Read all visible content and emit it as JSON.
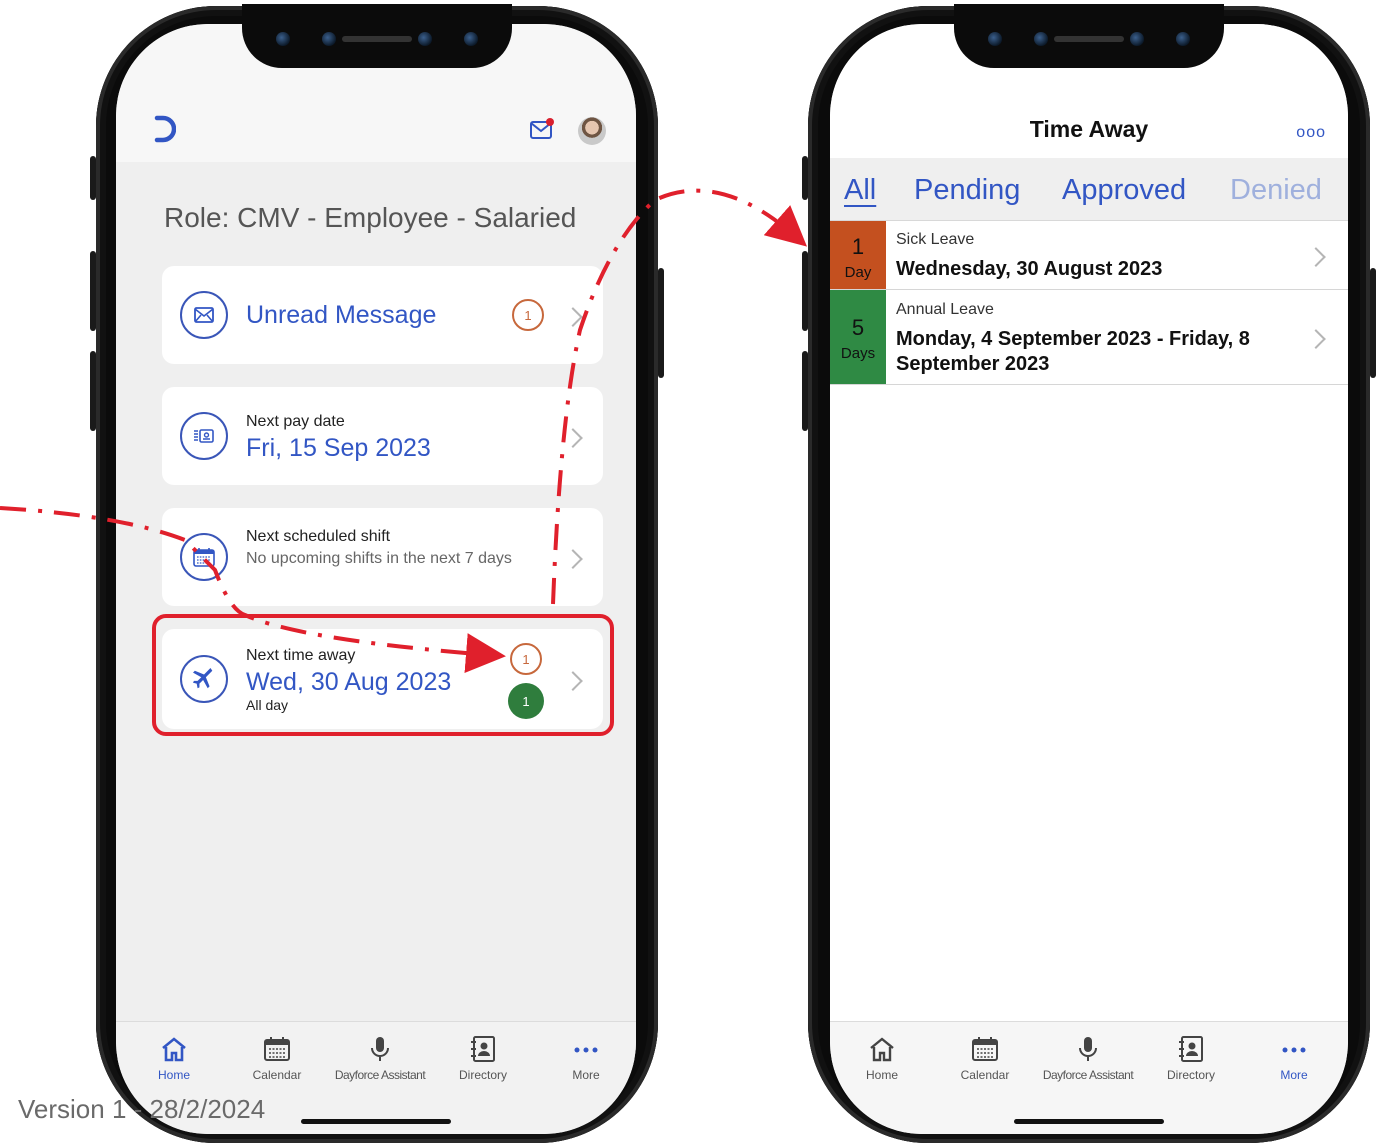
{
  "left_phone": {
    "role": "Role: CMV - Employee - Salaried",
    "cards": {
      "unread": {
        "label": "Unread Message",
        "badge": "1"
      },
      "pay": {
        "label": "Next pay date",
        "value": "Fri, 15 Sep 2023"
      },
      "shift": {
        "label": "Next scheduled shift",
        "value": "No upcoming shifts in the next 7 days"
      },
      "timeaway": {
        "label": "Next time away",
        "value": "Wed, 30 Aug 2023",
        "sub": "All day",
        "badge_pending": "1",
        "badge_approved": "1"
      }
    },
    "nav": [
      {
        "label": "Home"
      },
      {
        "label": "Calendar"
      },
      {
        "label": "Dayforce Assistant"
      },
      {
        "label": "Directory"
      },
      {
        "label": "More"
      }
    ]
  },
  "right_phone": {
    "title": "Time Away",
    "more": "ooo",
    "tabs": [
      "All",
      "Pending",
      "Approved",
      "Denied"
    ],
    "rows": [
      {
        "count": "1",
        "unit": "Day",
        "type": "Sick Leave",
        "date": "Wednesday, 30 August 2023",
        "color": "#c4501f"
      },
      {
        "count": "5",
        "unit": "Days",
        "type": "Annual Leave",
        "date": "Monday, 4 September 2023 - Friday, 8 September 2023",
        "color": "#2f8a44"
      }
    ],
    "nav": [
      {
        "label": "Home"
      },
      {
        "label": "Calendar"
      },
      {
        "label": "Dayforce Assistant"
      },
      {
        "label": "Directory"
      },
      {
        "label": "More"
      }
    ]
  },
  "version": "Version 1 - 28/2/2024",
  "colors": {
    "accent": "#3256c4",
    "highlight": "#e0202c",
    "pending": "#c7683c",
    "approved": "#2f7d3d"
  }
}
